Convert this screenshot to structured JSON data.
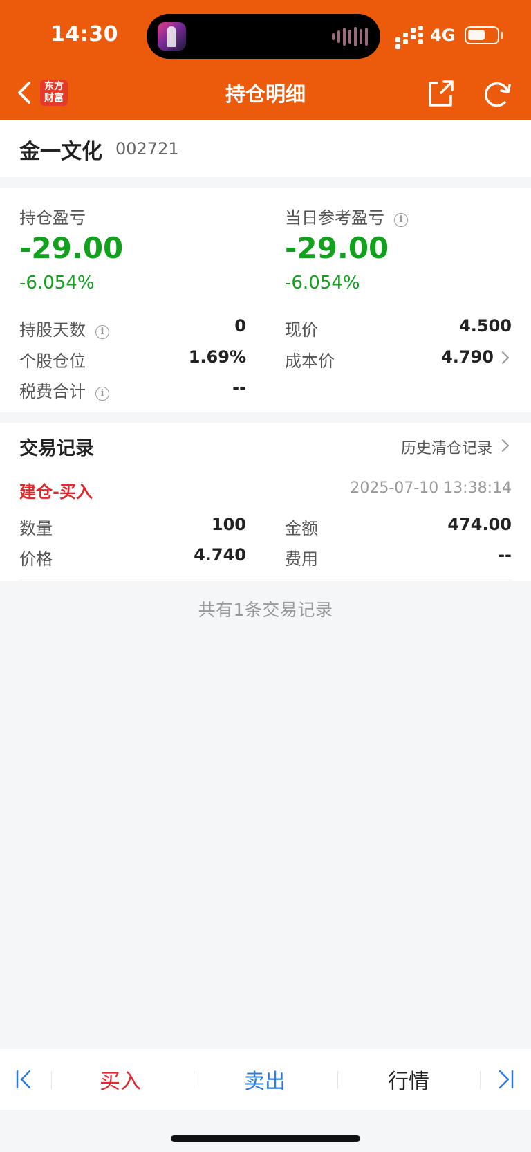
{
  "status_bar": {
    "time": "14:30",
    "network": "4G"
  },
  "nav": {
    "brand_logo": "东方财富",
    "title": "持仓明细"
  },
  "stock": {
    "name": "金一文化",
    "code": "002721"
  },
  "summary": {
    "position_pl_label": "持仓盈亏",
    "position_pl_value": "-29.00",
    "position_pl_pct": "-6.054%",
    "daily_pl_label": "当日参考盈亏",
    "daily_pl_value": "-29.00",
    "daily_pl_pct": "-6.054%",
    "info_glyph": "i",
    "rows": [
      {
        "label": "持股天数",
        "value": "0"
      },
      {
        "label": "个股仓位",
        "value": "1.69%"
      },
      {
        "label": "税费合计",
        "value": "--"
      },
      {
        "label": "现价",
        "value": "4.500"
      },
      {
        "label": "成本价",
        "value": "4.790"
      }
    ]
  },
  "trades": {
    "title": "交易记录",
    "history_link": "历史清仓记录",
    "records": [
      {
        "type": "建仓-买入",
        "time": "2025-07-10 13:38:14",
        "quantity_label": "数量",
        "quantity": "100",
        "amount_label": "金额",
        "amount": "474.00",
        "price_label": "价格",
        "price": "4.740",
        "fee_label": "费用",
        "fee": "--"
      }
    ],
    "count_text": "共有1条交易记录"
  },
  "toolbar": {
    "buy": "买入",
    "sell": "卖出",
    "quote": "行情"
  },
  "colors": {
    "header": "#ec5a0c",
    "loss_green": "#11a11d",
    "buy_red": "#e3262c",
    "sell_blue": "#2a7be0"
  },
  "icons": [
    "back-arrow-icon",
    "share-icon",
    "refresh-icon",
    "info-icon",
    "chevron-right-icon",
    "first-page-icon",
    "last-page-icon"
  ]
}
